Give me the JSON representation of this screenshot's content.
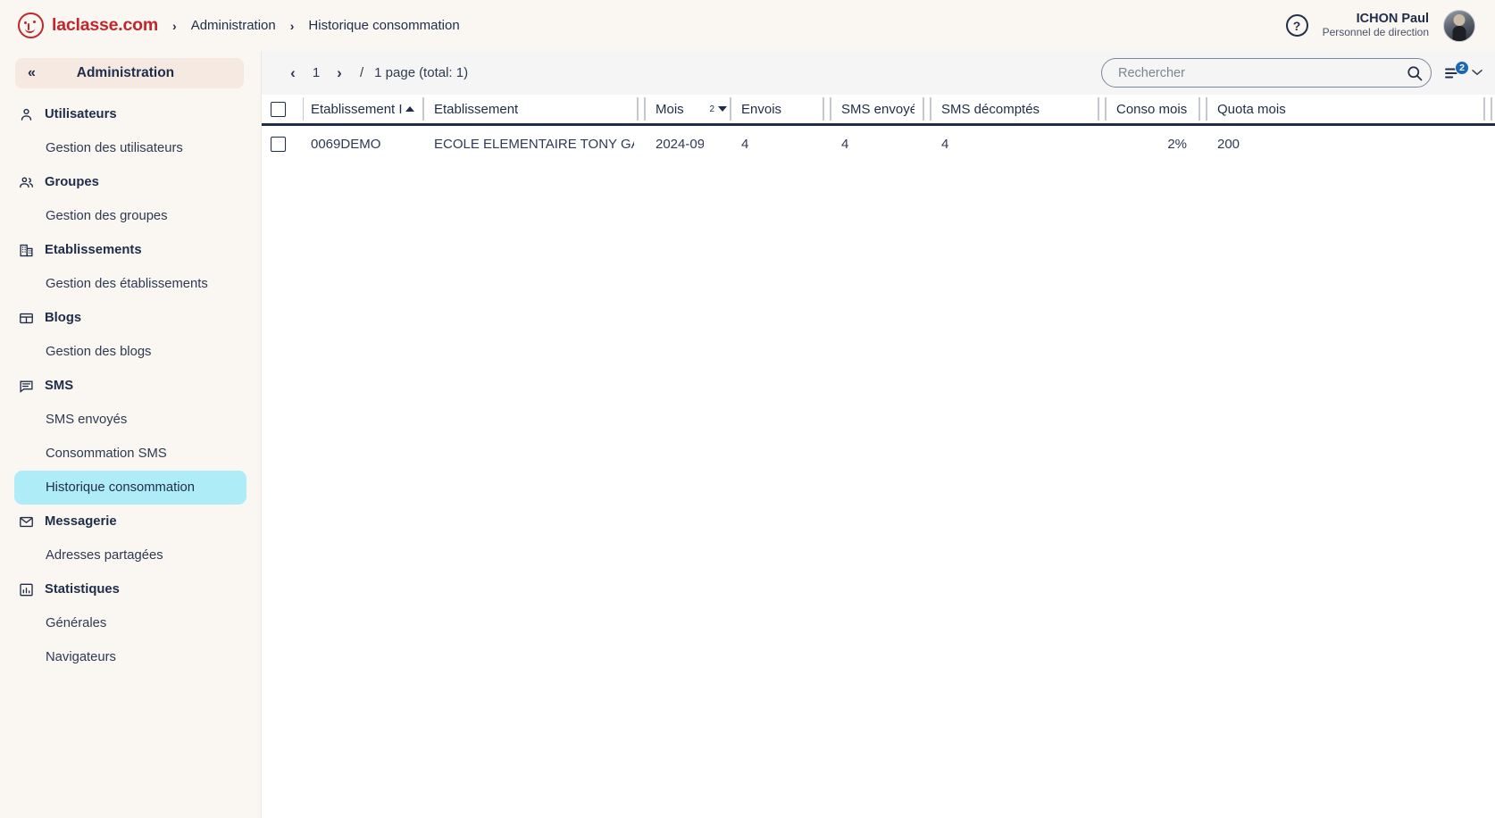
{
  "topbar": {
    "brand_name": "laclasse.com",
    "breadcrumb": [
      "Administration",
      "Historique consommation"
    ],
    "breadcrumb_separator": "›",
    "help_label": "?",
    "user_name": "ICHON Paul",
    "user_role": "Personnel de direction",
    "brand_color": "#c0272d"
  },
  "sidebar": {
    "collapse_label": "«",
    "title": "Administration",
    "items": [
      {
        "label": "Utilisateurs",
        "type": "group",
        "icon": "user-icon"
      },
      {
        "label": "Gestion des utilisateurs",
        "type": "child",
        "active": false
      },
      {
        "label": "Groupes",
        "type": "group",
        "icon": "users-icon"
      },
      {
        "label": "Gestion des groupes",
        "type": "child",
        "active": false
      },
      {
        "label": "Etablissements",
        "type": "group",
        "icon": "building-icon"
      },
      {
        "label": "Gestion des établissements",
        "type": "child",
        "active": false
      },
      {
        "label": "Blogs",
        "type": "group",
        "icon": "blog-icon"
      },
      {
        "label": "Gestion des blogs",
        "type": "child",
        "active": false
      },
      {
        "label": "SMS",
        "type": "group",
        "icon": "message-icon"
      },
      {
        "label": "SMS envoyés",
        "type": "child",
        "active": false
      },
      {
        "label": "Consommation SMS",
        "type": "child",
        "active": false
      },
      {
        "label": "Historique consommation",
        "type": "child",
        "active": true
      },
      {
        "label": "Messagerie",
        "type": "group",
        "icon": "envelope-icon"
      },
      {
        "label": "Adresses partagées",
        "type": "child",
        "active": false
      },
      {
        "label": "Statistiques",
        "type": "group",
        "icon": "chart-icon"
      },
      {
        "label": "Générales",
        "type": "child",
        "active": false
      },
      {
        "label": "Navigateurs",
        "type": "child",
        "active": false
      }
    ],
    "active_highlight_color": "#aeecf7"
  },
  "toolbar": {
    "prev_label": "‹",
    "next_label": "›",
    "current_page": "1",
    "slash": "/",
    "page_count_label": "1 page",
    "total_label": "(total: 1)",
    "search_placeholder": "Rechercher",
    "search_value": "",
    "search_icon": "search-icon",
    "filter_badge": "2",
    "filter_chevron": "⌄",
    "badge_color": "#1769b5"
  },
  "table": {
    "select_all_checked": false,
    "columns": [
      {
        "key": "etablissement_id",
        "label": "Etablissement Id",
        "sort": "asc",
        "sort_order": ""
      },
      {
        "key": "etablissement",
        "label": "Etablissement",
        "sort": "",
        "sort_order": ""
      },
      {
        "key": "mois",
        "label": "Mois",
        "sort": "desc",
        "sort_order": "2"
      },
      {
        "key": "envois",
        "label": "Envois",
        "sort": "",
        "sort_order": ""
      },
      {
        "key": "sms_envoyes",
        "label": "SMS envoyé",
        "sort": "",
        "sort_order": ""
      },
      {
        "key": "sms_decomptes",
        "label": "SMS décomptés",
        "sort": "",
        "sort_order": ""
      },
      {
        "key": "conso_mois",
        "label": "Conso mois",
        "sort": "",
        "sort_order": ""
      },
      {
        "key": "quota_mois",
        "label": "Quota mois",
        "sort": "",
        "sort_order": ""
      }
    ],
    "rows": [
      {
        "checked": false,
        "etablissement_id": "0069DEMO",
        "etablissement": "ECOLE ELEMENTAIRE TONY GAR",
        "mois": "2024-09",
        "envois": "4",
        "sms_envoyes": "4",
        "sms_decomptes": "4",
        "conso_mois": "2%",
        "quota_mois": "200"
      }
    ]
  }
}
